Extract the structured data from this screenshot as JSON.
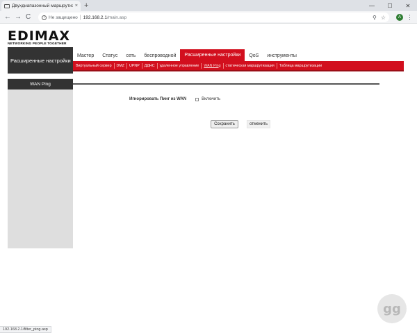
{
  "browser": {
    "tab_title": "Двухдиапазонный маршрутиз",
    "tab_close": "×",
    "new_tab": "+",
    "win_min": "—",
    "win_max": "☐",
    "win_close": "✕",
    "nav_back": "←",
    "nav_forward": "→",
    "nav_reload": "C",
    "insecure_label": "Не защищено",
    "address_separator": "|",
    "url_host": "192.168.2.1",
    "url_path": "/main.asp",
    "zoom_icon": "⚲",
    "bookmark_icon": "☆",
    "profile_initial": "A",
    "menu_icon": "⋮",
    "status_url": "192.168.2.1/filter_ping.asp"
  },
  "logo": {
    "brand": "EDIMAX",
    "tagline": "NETWORKING PEOPLE TOGETHER"
  },
  "sidebar": {
    "heading": "Расширенные настройки",
    "section_label": "WAN Ping"
  },
  "topnav": [
    {
      "label": "Мастер"
    },
    {
      "label": "Статус"
    },
    {
      "label": "сеть"
    },
    {
      "label": "беспроводной"
    },
    {
      "label": "Расширенные настройки",
      "active": true
    },
    {
      "label": "QoS"
    },
    {
      "label": "инструменты"
    }
  ],
  "subnav": [
    {
      "label": "Виртуальный сервер"
    },
    {
      "label": "DMZ"
    },
    {
      "label": "UPNP"
    },
    {
      "label": "ДДНС"
    },
    {
      "label": "удаленное управление"
    },
    {
      "label": "WAN Ping",
      "current": true
    },
    {
      "label": "статическая маршрутизация"
    },
    {
      "label": "Таблица маршрутизации"
    }
  ],
  "form": {
    "ignore_ping_label": "Игнорировать Пинг из WAN",
    "enable_label": "Включить",
    "enable_checked": false
  },
  "buttons": {
    "save": "Сохранить",
    "cancel": "отменить"
  },
  "watermark_text": "gg",
  "colors": {
    "accent_red": "#d20f1e",
    "dark_panel": "#333333",
    "side_gray": "#dedede"
  }
}
